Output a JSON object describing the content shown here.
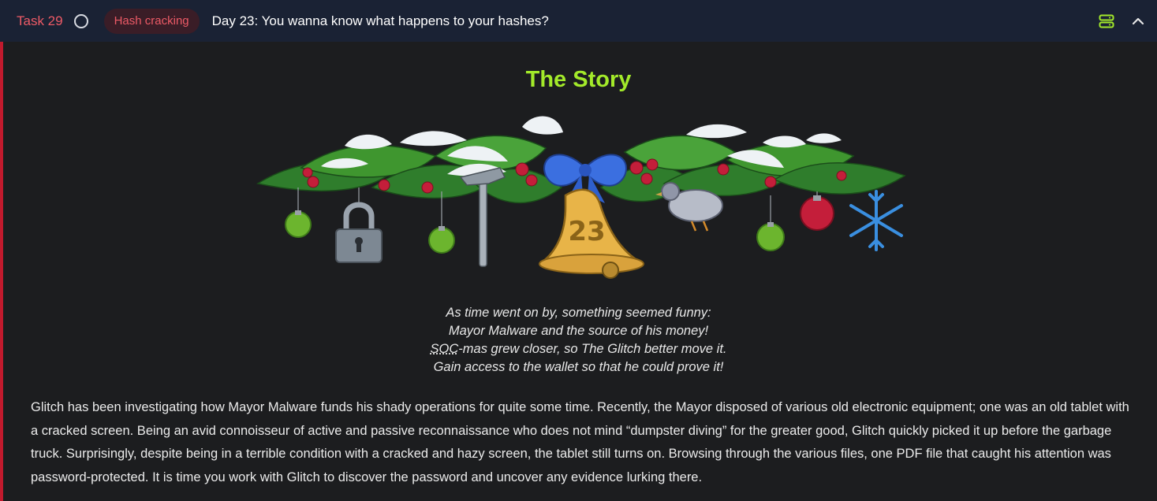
{
  "header": {
    "task_label": "Task 29",
    "tag": "Hash cracking",
    "title": "Day 23: You wanna know what happens to your hashes?"
  },
  "story": {
    "heading": "The Story",
    "banner_number": "23",
    "poem": {
      "line1": "As time went on by, something seemed funny:",
      "line2": "Mayor Malware and the source of his money!",
      "line3_abbr": "SOC",
      "line3_rest": "-mas grew closer, so The Glitch better move it.",
      "line4": "Gain access to the wallet so that he could prove it!"
    },
    "body": "Glitch has been investigating how Mayor Malware funds his shady operations for quite some time. Recently, the Mayor disposed of various old electronic equipment; one was an old tablet with a cracked screen. Being an avid connoisseur of active and passive reconnaissance who does not mind “dumpster diving” for the greater good, Glitch quickly picked it up before the garbage truck. Surprisingly, despite being in a terrible condition with a cracked and hazy screen, the tablet still turns on. Browsing through the various files, one PDF file that caught his attention was password-protected. It is time you work with Glitch to discover the password and uncover any evidence lurking there."
  },
  "colors": {
    "header_bg": "#1a2234",
    "accent_red": "#ec5a66",
    "title_green": "#a3ea2a",
    "icon_green": "#a3ea2a",
    "left_bar": "#c11a2d"
  },
  "icons": {
    "status": "circle-outline-icon",
    "view_toggle": "split-view-icon",
    "collapse": "chevron-up-icon"
  }
}
